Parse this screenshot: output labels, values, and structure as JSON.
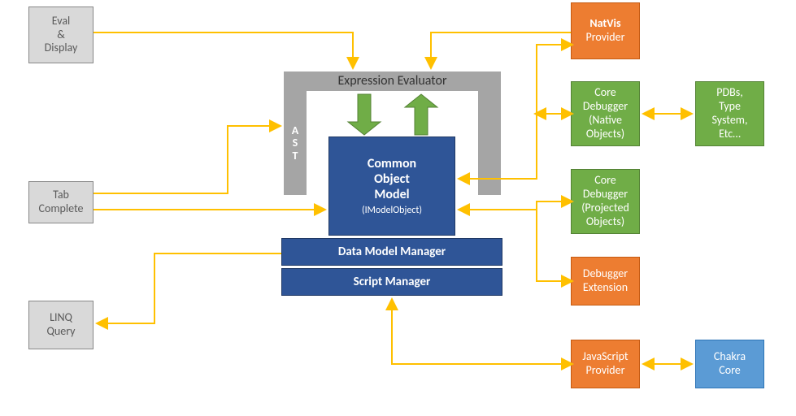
{
  "boxes": {
    "eval_display": "Eval\n&\nDisplay",
    "tab_complete": "Tab\nComplete",
    "linq_query": "LINQ\nQuery",
    "expr_eval": "Expression Evaluator",
    "ast": "A\nS\nT",
    "common_object_model": "Common\nObject\nModel",
    "imodelobject": "(IModelObject)",
    "data_model_manager": "Data Model Manager",
    "script_manager": "Script Manager",
    "natvis_bold": "NatVis",
    "natvis_sub": "Provider",
    "core_debugger_native": "Core\nDebugger\n(Native\nObjects)",
    "pdbs": "PDBs,\nType\nSystem,\nEtc…",
    "core_debugger_projected": "Core\nDebugger\n(Projected\nObjects)",
    "debugger_ext": "Debugger\nExtension",
    "js_provider": "JavaScript\nProvider",
    "chakra": "Chakra\nCore"
  },
  "colors": {
    "arrow": "#ffc000",
    "green_arrow": "#70ad47"
  }
}
